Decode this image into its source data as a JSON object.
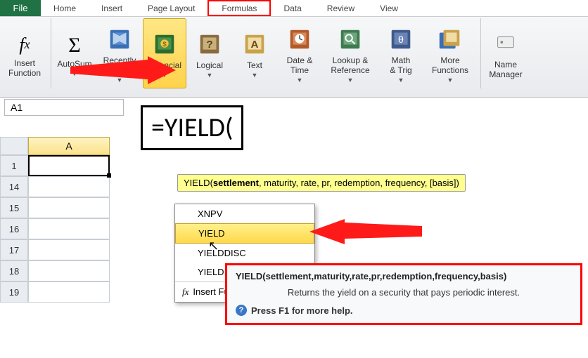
{
  "tabs": {
    "file": "File",
    "items": [
      "Home",
      "Insert",
      "Page Layout",
      "Formulas",
      "Data",
      "Review",
      "View"
    ],
    "activeIndex": 3
  },
  "ribbon": {
    "insertFunction": "Insert\nFunction",
    "autoSum": "AutoSum",
    "recently": "Recently\nUsed",
    "financial": "Financial",
    "logical": "Logical",
    "text": "Text",
    "dateTime": "Date &\nTime",
    "lookup": "Lookup &\nReference",
    "math": "Math\n& Trig",
    "more": "More\nFunctions",
    "nameMgr": "Name\nManager"
  },
  "namebox": "A1",
  "formula": "=YIELD(",
  "sigTooltip": {
    "fn": "YIELD",
    "param1": "settlement",
    "rest": ", maturity, rate, pr, redemption, frequency, [basis])"
  },
  "dropdown": {
    "items": [
      "XNPV",
      "YIELD",
      "YIELDDISC",
      "YIELD..."
    ],
    "selectedIndex": 1,
    "insertFn": "Insert Function..."
  },
  "help": {
    "sig": "YIELD(settlement,maturity,rate,pr,redemption,frequency,basis)",
    "desc": "Returns the yield on a security that pays periodic interest.",
    "more": "Press F1 for more help."
  },
  "grid": {
    "col": "A",
    "rows": [
      "1",
      "14",
      "15",
      "16",
      "17",
      "18",
      "19"
    ]
  },
  "fxLabel": "fx"
}
